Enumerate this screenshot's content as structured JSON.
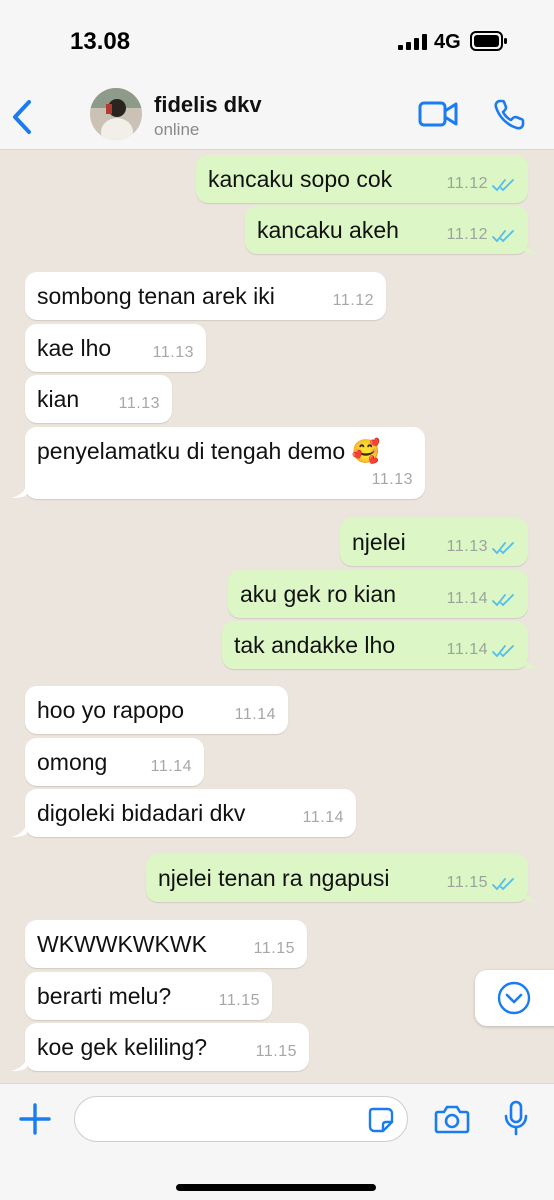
{
  "status_bar": {
    "time": "13.08",
    "network": "4G"
  },
  "header": {
    "contact_name": "fidelis dkv",
    "contact_status": "online"
  },
  "colors": {
    "accent": "#1A7CF0",
    "outgoing_bubble": "#DCF7C5",
    "incoming_bubble": "#FFFFFF",
    "chat_background": "#ECE5DD",
    "read_ticks": "#53BDEB"
  },
  "icons": {
    "back": "chevron-left-icon",
    "video": "video-camera-icon",
    "call": "phone-icon",
    "scroll": "chevron-down-circle-icon",
    "plus": "plus-icon",
    "sticker": "sticker-icon",
    "camera": "camera-icon",
    "mic": "microphone-icon"
  },
  "messages": [
    {
      "direction": "out",
      "text": "kancaku sopo cok",
      "time": "11.12",
      "status": "read"
    },
    {
      "direction": "out",
      "text": "kancaku akeh",
      "time": "11.12",
      "status": "read"
    },
    {
      "direction": "in",
      "text": "sombong tenan arek iki",
      "time": "11.12"
    },
    {
      "direction": "in",
      "text": "kae lho",
      "time": "11.13"
    },
    {
      "direction": "in",
      "text": "kian",
      "time": "11.13"
    },
    {
      "direction": "in",
      "text": "penyelamatku di tengah demo 🥰",
      "time": "11.13"
    },
    {
      "direction": "out",
      "text": "njelei",
      "time": "11.13",
      "status": "read"
    },
    {
      "direction": "out",
      "text": "aku gek ro kian",
      "time": "11.14",
      "status": "read"
    },
    {
      "direction": "out",
      "text": "tak andakke lho",
      "time": "11.14",
      "status": "read"
    },
    {
      "direction": "in",
      "text": "hoo yo rapopo",
      "time": "11.14"
    },
    {
      "direction": "in",
      "text": "omong",
      "time": "11.14"
    },
    {
      "direction": "in",
      "text": "digoleki bidadari dkv",
      "time": "11.14"
    },
    {
      "direction": "out",
      "text": "njelei tenan ra ngapusi",
      "time": "11.15",
      "status": "read"
    },
    {
      "direction": "in",
      "text": "WKWWKWKWK",
      "time": "11.15"
    },
    {
      "direction": "in",
      "text": "berarti melu?",
      "time": "11.15"
    },
    {
      "direction": "in",
      "text": "koe gek keliling?",
      "time": "11.15"
    }
  ],
  "composer": {
    "placeholder": ""
  }
}
